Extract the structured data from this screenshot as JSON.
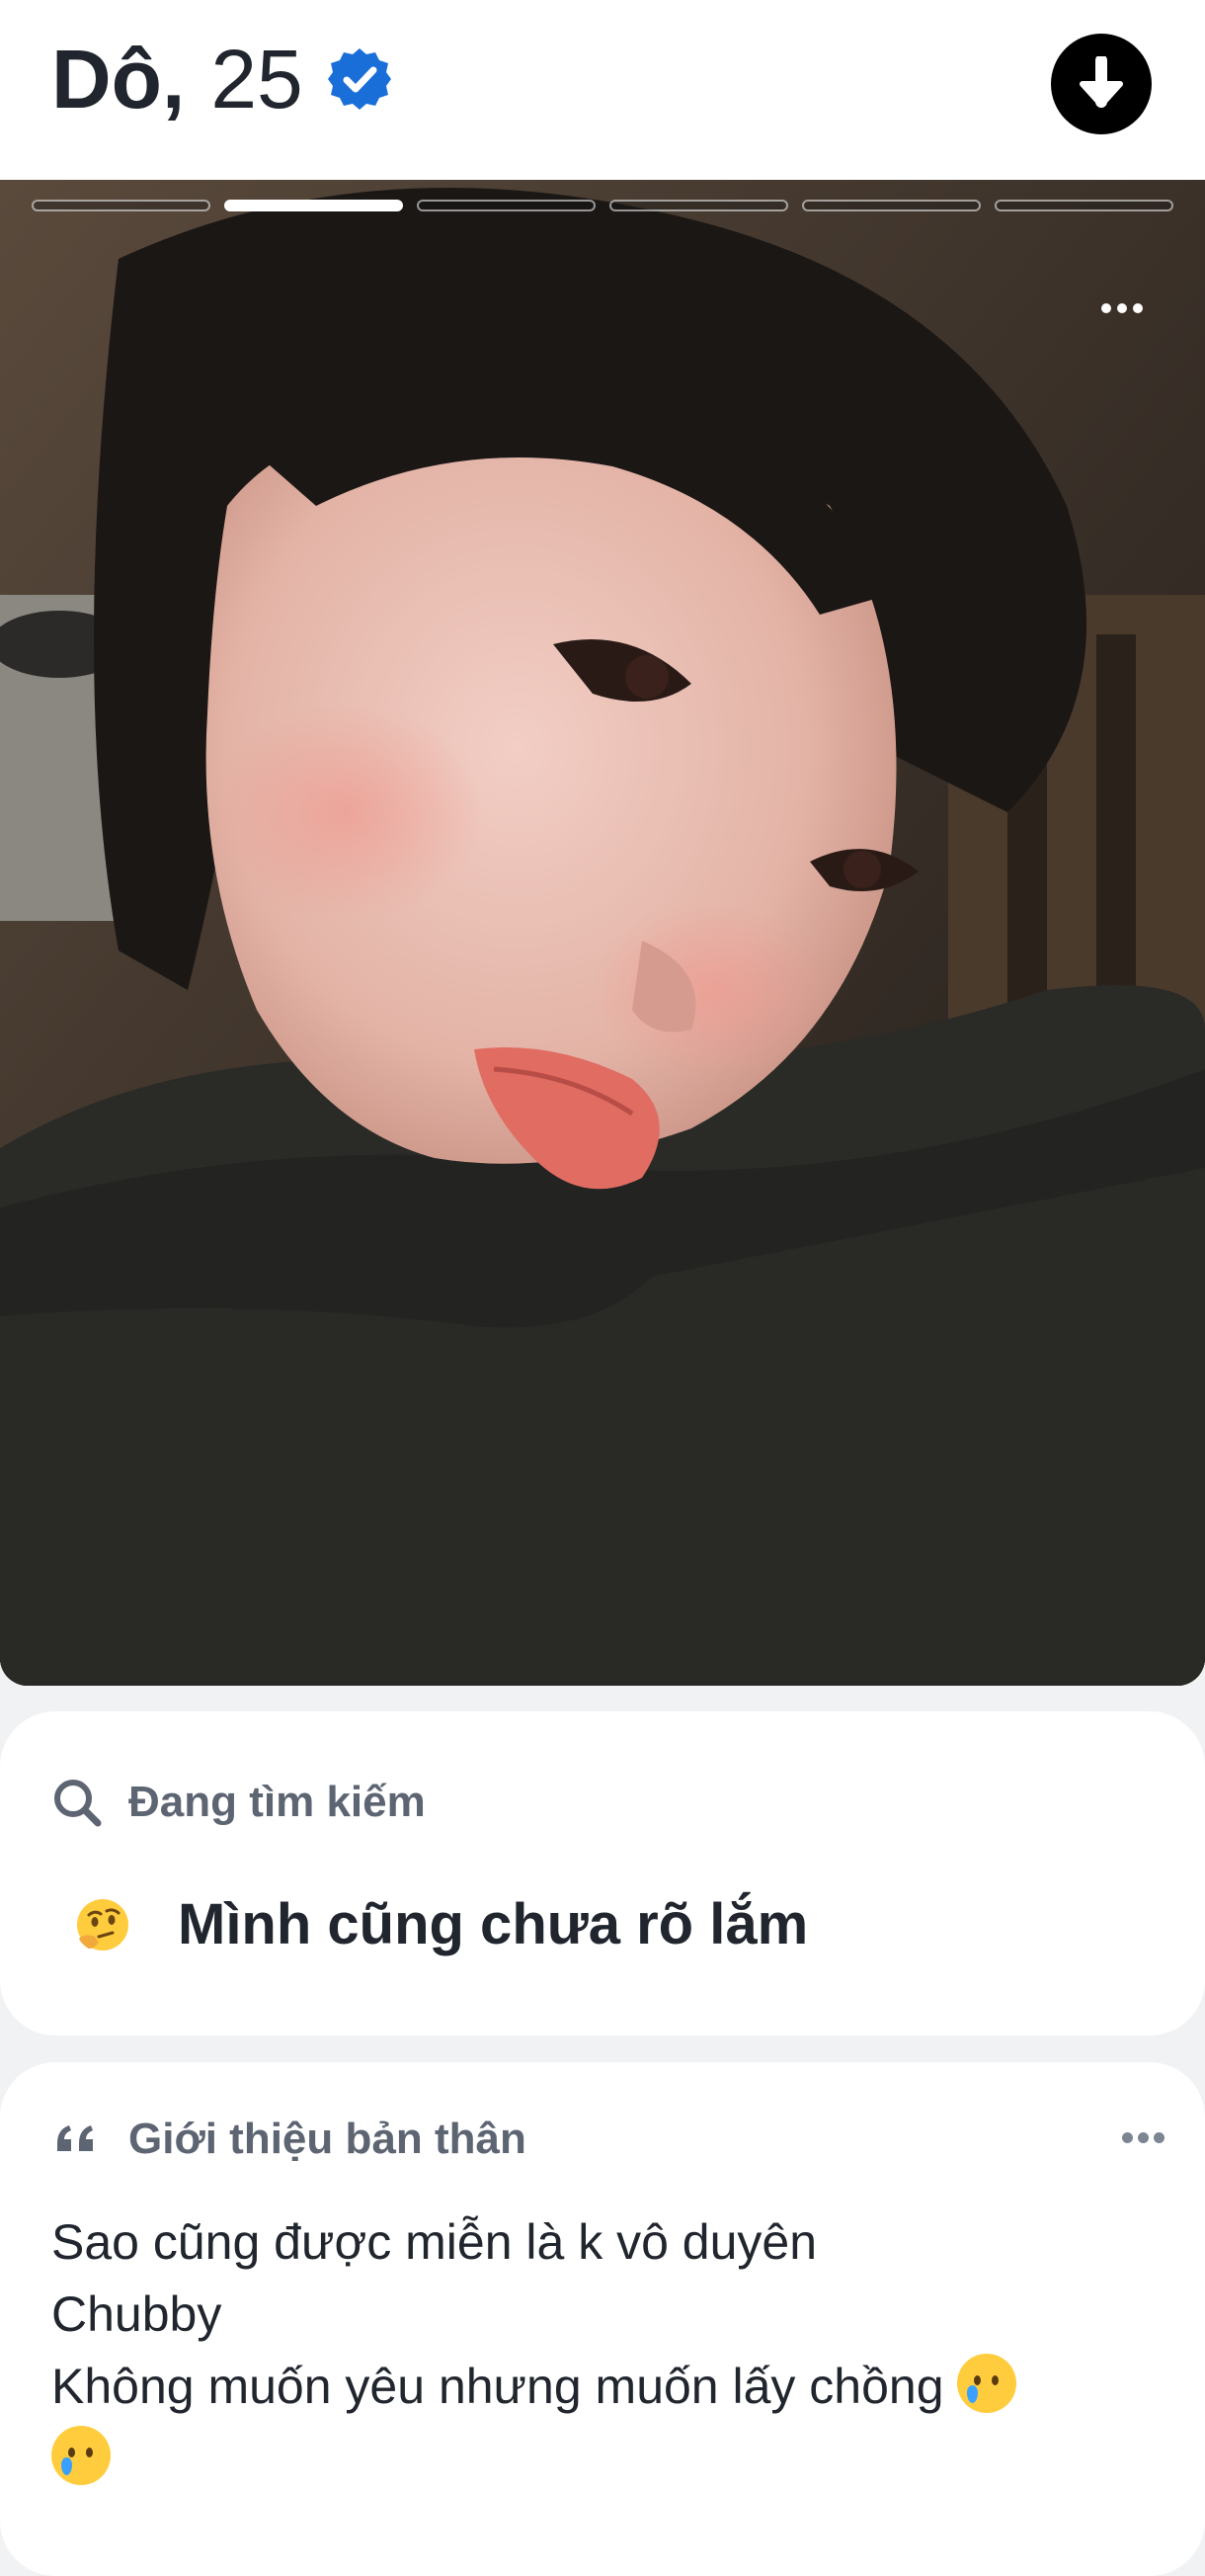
{
  "profile": {
    "name": "Dô,",
    "age": "25",
    "verified_icon": "verified-badge-icon",
    "collapse_icon": "arrow-down-icon"
  },
  "photo": {
    "count": 6,
    "active_index": 1,
    "more_icon": "more-dots-icon"
  },
  "looking_for": {
    "label": "Đang tìm kiếm",
    "icon": "search-icon",
    "emoji": "thinking-face-emoji",
    "value": "Mình cũng chưa rõ lắm"
  },
  "about": {
    "label": "Giới thiệu bản thân",
    "icon": "quote-icon",
    "line1": "Sao cũng được miễn là k vô duyên",
    "line2": "Chubby",
    "line3": "Không muốn yêu nhưng muốn lấy chồng",
    "emojis": [
      "smiling-face-with-tear-emoji",
      "smiling-face-with-tear-emoji"
    ]
  },
  "colors": {
    "verified_blue": "#1a6ed8",
    "text_dark": "#21262e",
    "label_gray": "#5d6572",
    "page_bg": "#f0f2f4"
  }
}
